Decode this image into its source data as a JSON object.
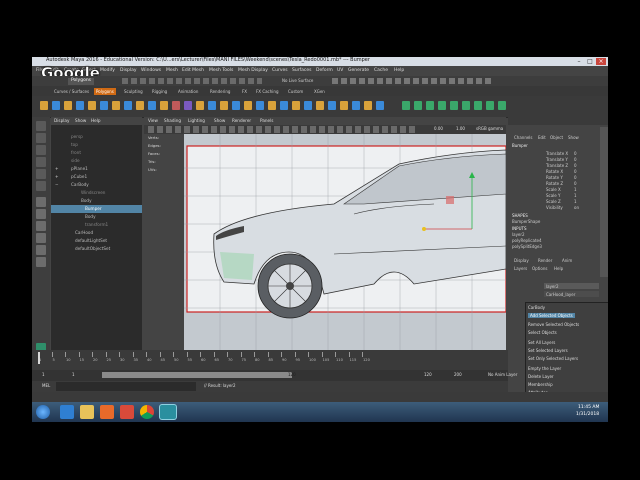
{
  "window": {
    "title": "Autodesk Maya 2016 - Educational Version: C:\\U...ers\\Lecturer\\Files\\MANI FILES\\Weekend\\scenes\\Tesla_Redo0001.mb* --- Bumper"
  },
  "overlay": {
    "logo": "Google"
  },
  "menubar": {
    "items": [
      "File",
      "Edit",
      "Create",
      "Select",
      "Modify",
      "Display",
      "Windows",
      "Mesh",
      "Edit Mesh",
      "Mesh Tools",
      "Mesh Display",
      "Curves",
      "Surfaces",
      "Deform",
      "UV",
      "Generate",
      "Cache",
      "Help"
    ]
  },
  "statusline": {
    "mode": "Polygons",
    "symmetry": "No Live Surface"
  },
  "shelf": {
    "tabs": [
      "Curves / Surfaces",
      "Polygons",
      "Sculpting",
      "Rigging",
      "Animation",
      "Rendering",
      "FX",
      "FX Caching",
      "Custom",
      "XGen"
    ],
    "active_tab": "Polygons"
  },
  "outliner": {
    "menu": [
      "Display",
      "Show",
      "Help"
    ],
    "items": [
      {
        "label": "persp",
        "selected": false
      },
      {
        "label": "top",
        "selected": false
      },
      {
        "label": "front",
        "selected": false
      },
      {
        "label": "side",
        "selected": false
      },
      {
        "label": "pPlane1",
        "selected": false
      },
      {
        "label": "pCube1",
        "selected": false
      },
      {
        "label": "CarBody",
        "selected": false
      },
      {
        "label": "Windscreen",
        "selected": false
      },
      {
        "label": "Body",
        "selected": false
      },
      {
        "label": "Bumper",
        "selected": true
      },
      {
        "label": "Body",
        "selected": false
      },
      {
        "label": "transform1",
        "selected": false
      },
      {
        "label": "CarHood",
        "selected": false
      },
      {
        "label": "defaultLightSet",
        "selected": false
      },
      {
        "label": "defaultObjectSet",
        "selected": false
      }
    ]
  },
  "panel": {
    "menu": [
      "View",
      "Shading",
      "Lighting",
      "Show",
      "Renderer",
      "Panels"
    ],
    "toolbar": {
      "value1": "0.00",
      "value2": "1.00",
      "colorspace": "sRGB gamma"
    },
    "hud": [
      "Verts:",
      "Edges:",
      "Faces:",
      "Tris:",
      "UVs:"
    ]
  },
  "channelbox": {
    "tabs": [
      "Channels",
      "Edit",
      "Object",
      "Show"
    ],
    "object": "Bumper",
    "attributes": [
      {
        "name": "Translate X",
        "value": "0"
      },
      {
        "name": "Translate Y",
        "value": "0"
      },
      {
        "name": "Translate Z",
        "value": "0"
      },
      {
        "name": "Rotate X",
        "value": "0"
      },
      {
        "name": "Rotate Y",
        "value": "0"
      },
      {
        "name": "Rotate Z",
        "value": "0"
      },
      {
        "name": "Scale X",
        "value": "1"
      },
      {
        "name": "Scale Y",
        "value": "1"
      },
      {
        "name": "Scale Z",
        "value": "1"
      },
      {
        "name": "Visibility",
        "value": "on"
      }
    ],
    "shapes_header": "SHAPES",
    "shapes": [
      "BumperShape"
    ],
    "inputs_header": "INPUTS",
    "inputs": [
      "layer2",
      "polyReplicate4",
      "polySplitEdge3"
    ],
    "layer_tabs": [
      "Display",
      "Render",
      "Anim"
    ],
    "layer_menu": [
      "Layers",
      "Options",
      "Help"
    ],
    "layers": [
      "layer2",
      "CarHood_layer"
    ]
  },
  "context_menu": {
    "items": [
      {
        "label": "CarBody",
        "highlighted": false
      },
      {
        "label": "Add Selected Objects",
        "highlighted": true
      },
      {
        "label": "Remove Selected Objects",
        "highlighted": false
      },
      {
        "label": "Select Objects",
        "highlighted": false
      },
      {
        "label": "Set All Layers",
        "highlighted": false
      },
      {
        "label": "Set Selected Layers",
        "highlighted": false
      },
      {
        "label": "Set Only Selected Layers",
        "highlighted": false
      },
      {
        "label": "Empty the Layer",
        "highlighted": false
      },
      {
        "label": "Delete Layer",
        "highlighted": false
      },
      {
        "label": "Membership",
        "highlighted": false
      },
      {
        "label": "Attributes",
        "highlighted": false
      }
    ]
  },
  "timeline": {
    "ticks": [
      "1",
      "5",
      "10",
      "15",
      "20",
      "25",
      "30",
      "35",
      "40",
      "45",
      "50",
      "55",
      "60",
      "65",
      "70",
      "75",
      "80",
      "85",
      "90",
      "95",
      "100",
      "105",
      "110",
      "115",
      "120"
    ],
    "current_frame": "1",
    "range_start": "1",
    "range_inner_start": "1",
    "range_inner_end": "120",
    "range_end_a": "120",
    "range_end_b": "200",
    "anim_layer": "No Anim Layer"
  },
  "command": {
    "lang": "MEL",
    "result": "// Result: layer2"
  },
  "taskbar": {
    "time": "11:45 AM",
    "date": "1/31/2018"
  },
  "colors": {
    "accent": "#d06a14",
    "selection": "#5285a6",
    "viewport_frame": "#cc2222"
  }
}
